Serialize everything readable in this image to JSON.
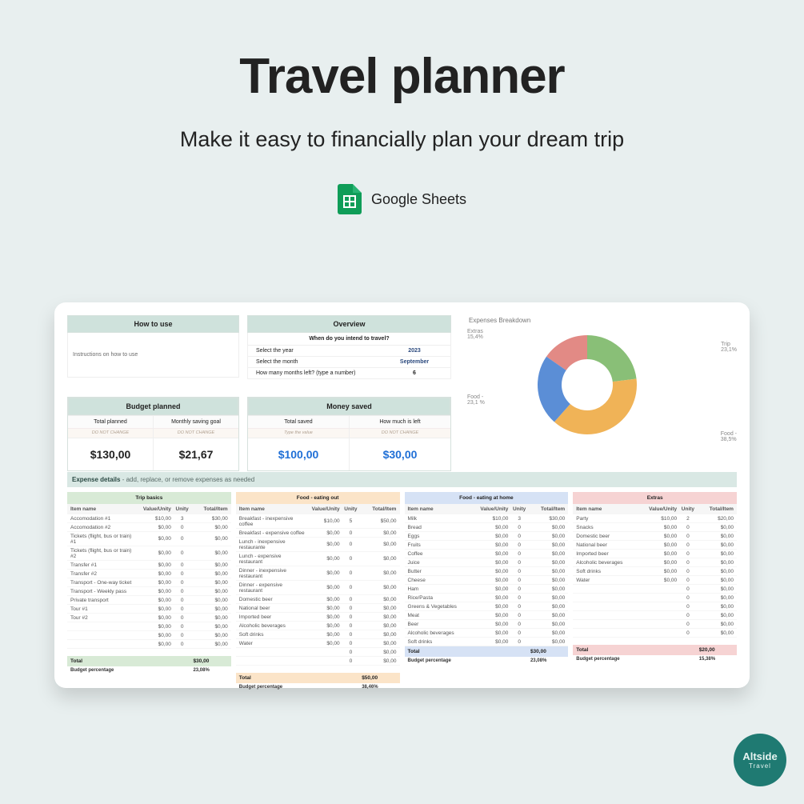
{
  "hero": {
    "title": "Travel planner",
    "subtitle": "Make it easy to financially plan your dream trip",
    "platform": "Google Sheets"
  },
  "badge": {
    "line1": "Altside",
    "line2": "Travel"
  },
  "howto": {
    "title": "How to use",
    "body": "Instructions on how to use"
  },
  "overview": {
    "title": "Overview",
    "subtitle": "When do you intend to travel?",
    "year_label": "Select the year",
    "year": "2023",
    "month_label": "Select the month",
    "month": "September",
    "left_label": "How many months left? (type a number)",
    "left": "6"
  },
  "budget_planned": {
    "title": "Budget planned",
    "total_label": "Total planned",
    "total_tip": "DO NOT CHANGE",
    "total": "$130,00",
    "goal_label": "Monthly saving goal",
    "goal_tip": "DO NOT CHANGE",
    "goal": "$21,67"
  },
  "money_saved": {
    "title": "Money saved",
    "saved_label": "Total saved",
    "saved_tip": "Type the value",
    "saved": "$100,00",
    "left_label": "How much is left",
    "left_tip": "DO NOT CHANGE",
    "left": "$30,00"
  },
  "chart_data": {
    "type": "pie",
    "title": "Expenses Breakdown",
    "series": [
      {
        "name": "Trip",
        "value": 23.1,
        "color": "#89bf77",
        "label": "Trip",
        "pct": "23,1%"
      },
      {
        "name": "Food - eating out",
        "value": 38.5,
        "color": "#f0b357",
        "label": "Food -",
        "pct": "38,5%"
      },
      {
        "name": "Food - eating at home",
        "value": 23.1,
        "color": "#5b8ed6",
        "label": "Food -",
        "pct": "23,1 %"
      },
      {
        "name": "Extras",
        "value": 15.4,
        "color": "#e28a85",
        "label": "Extras",
        "pct": "15,4%"
      }
    ]
  },
  "expense_details": {
    "title": "Expense details",
    "hint": " - add, replace, or remove expenses as needed",
    "columns": [
      "Item name",
      "Value/Unity",
      "Unity",
      "Total/Item"
    ],
    "tables": [
      {
        "name": "Trip basics",
        "color": "green",
        "rows": [
          [
            "Accomodation #1",
            "$10,00",
            "3",
            "$30,00"
          ],
          [
            "Accomodation #2",
            "$0,00",
            "0",
            "$0,00"
          ],
          [
            "Tickets (flight, bus or train) #1",
            "$0,00",
            "0",
            "$0,00"
          ],
          [
            "Tickets (flight, bus or train) #2",
            "$0,00",
            "0",
            "$0,00"
          ],
          [
            "Transfer #1",
            "$0,00",
            "0",
            "$0,00"
          ],
          [
            "Transfer #2",
            "$0,00",
            "0",
            "$0,00"
          ],
          [
            "Transport - One-way ticket",
            "$0,00",
            "0",
            "$0,00"
          ],
          [
            "Transport - Weekly pass",
            "$0,00",
            "0",
            "$0,00"
          ],
          [
            "Private transport",
            "$0,00",
            "0",
            "$0,00"
          ],
          [
            "Tour #1",
            "$0,00",
            "0",
            "$0,00"
          ],
          [
            "Tour #2",
            "$0,00",
            "0",
            "$0,00"
          ],
          [
            "",
            "$0,00",
            "0",
            "$0,00"
          ],
          [
            "",
            "$0,00",
            "0",
            "$0,00"
          ],
          [
            "",
            "$0,00",
            "0",
            "$0,00"
          ]
        ],
        "total": "$30,00",
        "pct": "23,08%"
      },
      {
        "name": "Food - eating out",
        "color": "orange",
        "rows": [
          [
            "Breakfast - inexpensive coffee",
            "$10,00",
            "5",
            "$50,00"
          ],
          [
            "Breakfast - expensive coffee",
            "$0,00",
            "0",
            "$0,00"
          ],
          [
            "Lunch - inexpensive restaurante",
            "$0,00",
            "0",
            "$0,00"
          ],
          [
            "Lunch - expensive restaurant",
            "$0,00",
            "0",
            "$0,00"
          ],
          [
            "Dinner - inexpensive restaurant",
            "$0,00",
            "0",
            "$0,00"
          ],
          [
            "Dinner - expensive restaurant",
            "$0,00",
            "0",
            "$0,00"
          ],
          [
            "Domestic beer",
            "$0,00",
            "0",
            "$0,00"
          ],
          [
            "National beer",
            "$0,00",
            "0",
            "$0,00"
          ],
          [
            "Imported beer",
            "$0,00",
            "0",
            "$0,00"
          ],
          [
            "Alcoholic beverages",
            "$0,00",
            "0",
            "$0,00"
          ],
          [
            "Soft drinks",
            "$0,00",
            "0",
            "$0,00"
          ],
          [
            "Water",
            "$0,00",
            "0",
            "$0,00"
          ],
          [
            "",
            "",
            "0",
            "$0,00"
          ],
          [
            "",
            "",
            "0",
            "$0,00"
          ]
        ],
        "total": "$50,00",
        "pct": "38,46%"
      },
      {
        "name": "Food - eating at home",
        "color": "blue",
        "rows": [
          [
            "Milk",
            "$10,00",
            "3",
            "$30,00"
          ],
          [
            "Bread",
            "$0,00",
            "0",
            "$0,00"
          ],
          [
            "Eggs",
            "$0,00",
            "0",
            "$0,00"
          ],
          [
            "Fruits",
            "$0,00",
            "0",
            "$0,00"
          ],
          [
            "Coffee",
            "$0,00",
            "0",
            "$0,00"
          ],
          [
            "Juice",
            "$0,00",
            "0",
            "$0,00"
          ],
          [
            "Butter",
            "$0,00",
            "0",
            "$0,00"
          ],
          [
            "Cheese",
            "$0,00",
            "0",
            "$0,00"
          ],
          [
            "Ham",
            "$0,00",
            "0",
            "$0,00"
          ],
          [
            "Rice/Pasta",
            "$0,00",
            "0",
            "$0,00"
          ],
          [
            "Greens & Vegetables",
            "$0,00",
            "0",
            "$0,00"
          ],
          [
            "Meat",
            "$0,00",
            "0",
            "$0,00"
          ],
          [
            "Beer",
            "$0,00",
            "0",
            "$0,00"
          ],
          [
            "Alcoholic beverages",
            "$0,00",
            "0",
            "$0,00"
          ],
          [
            "Soft drinks",
            "$0,00",
            "0",
            "$0,00"
          ]
        ],
        "total": "$30,00",
        "pct": "23,08%"
      },
      {
        "name": "Extras",
        "color": "red",
        "rows": [
          [
            "Party",
            "$10,00",
            "2",
            "$20,00"
          ],
          [
            "Snacks",
            "$0,00",
            "0",
            "$0,00"
          ],
          [
            "Domestic beer",
            "$0,00",
            "0",
            "$0,00"
          ],
          [
            "National beer",
            "$0,00",
            "0",
            "$0,00"
          ],
          [
            "Imported beer",
            "$0,00",
            "0",
            "$0,00"
          ],
          [
            "Alcoholic beverages",
            "$0,00",
            "0",
            "$0,00"
          ],
          [
            "Soft drinks",
            "$0,00",
            "0",
            "$0,00"
          ],
          [
            "Water",
            "$0,00",
            "0",
            "$0,00"
          ],
          [
            "",
            "",
            "0",
            "$0,00"
          ],
          [
            "",
            "",
            "0",
            "$0,00"
          ],
          [
            "",
            "",
            "0",
            "$0,00"
          ],
          [
            "",
            "",
            "0",
            "$0,00"
          ],
          [
            "",
            "",
            "0",
            "$0,00"
          ],
          [
            "",
            "",
            "0",
            "$0,00"
          ]
        ],
        "total": "$20,00",
        "pct": "15,38%"
      }
    ],
    "total_label": "Total",
    "pct_label": "Budget percentage"
  }
}
